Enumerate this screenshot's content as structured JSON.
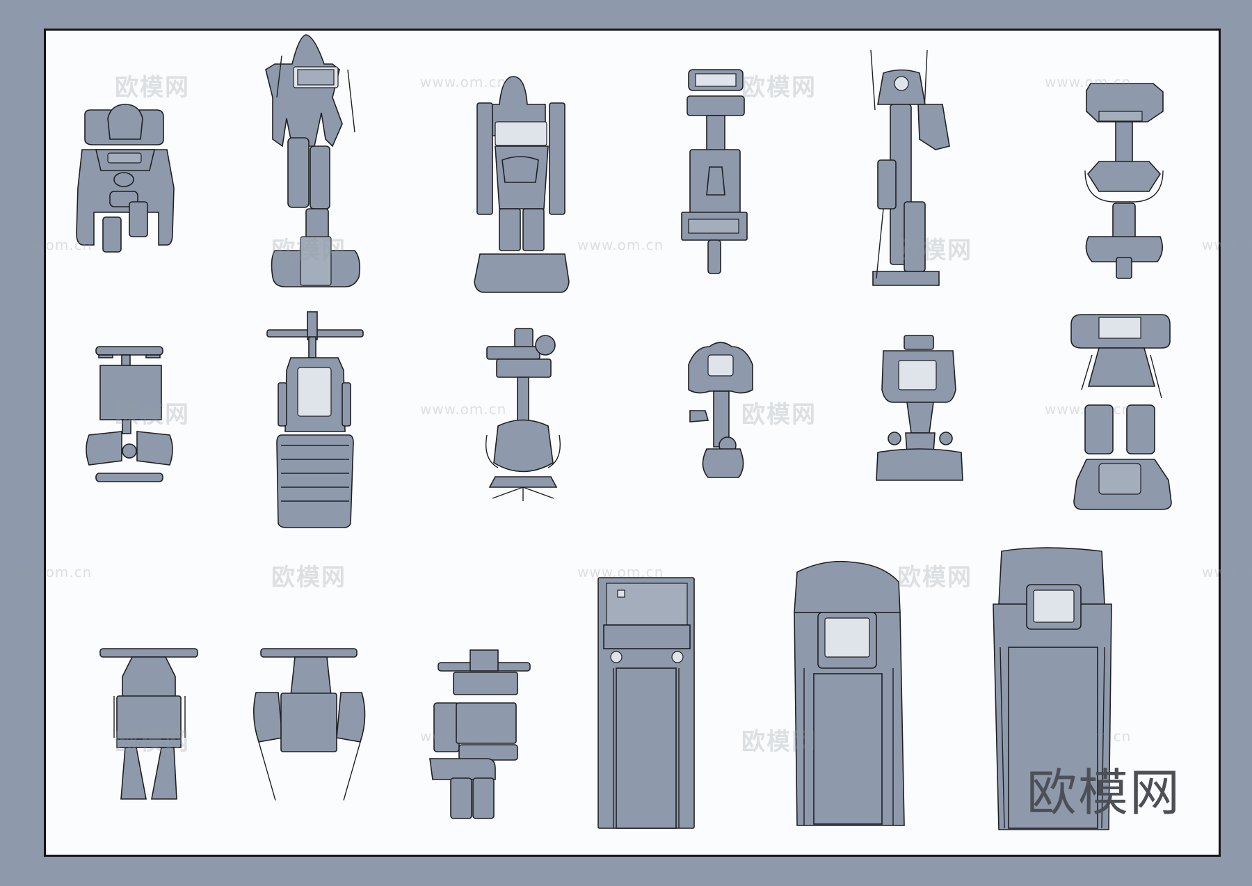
{
  "watermark": {
    "cn": "欧模网",
    "url": "www.om.cn"
  },
  "brand_mark": "欧模网",
  "colors": {
    "background": "#8e9aab",
    "sheet": "#fbfcfd",
    "equipment_fill": "#8e9aab",
    "outline": "#1e1f23"
  },
  "equipment": [
    {
      "row": 1,
      "kind": "recumbent-bike"
    },
    {
      "row": 1,
      "kind": "elliptical-trainer"
    },
    {
      "row": 1,
      "kind": "stair-climber"
    },
    {
      "row": 1,
      "kind": "upright-bike"
    },
    {
      "row": 1,
      "kind": "elliptical-trainer"
    },
    {
      "row": 1,
      "kind": "spin-bike"
    },
    {
      "row": 2,
      "kind": "abdominal-bench"
    },
    {
      "row": 2,
      "kind": "rowing-machine"
    },
    {
      "row": 2,
      "kind": "seated-bike"
    },
    {
      "row": 2,
      "kind": "upright-bike"
    },
    {
      "row": 2,
      "kind": "exercise-bike"
    },
    {
      "row": 2,
      "kind": "stepper"
    },
    {
      "row": 3,
      "kind": "weight-bench"
    },
    {
      "row": 3,
      "kind": "weight-bench"
    },
    {
      "row": 3,
      "kind": "leg-extension-bench"
    },
    {
      "row": 3,
      "kind": "treadmill"
    },
    {
      "row": 3,
      "kind": "treadmill"
    },
    {
      "row": 3,
      "kind": "treadmill"
    }
  ]
}
